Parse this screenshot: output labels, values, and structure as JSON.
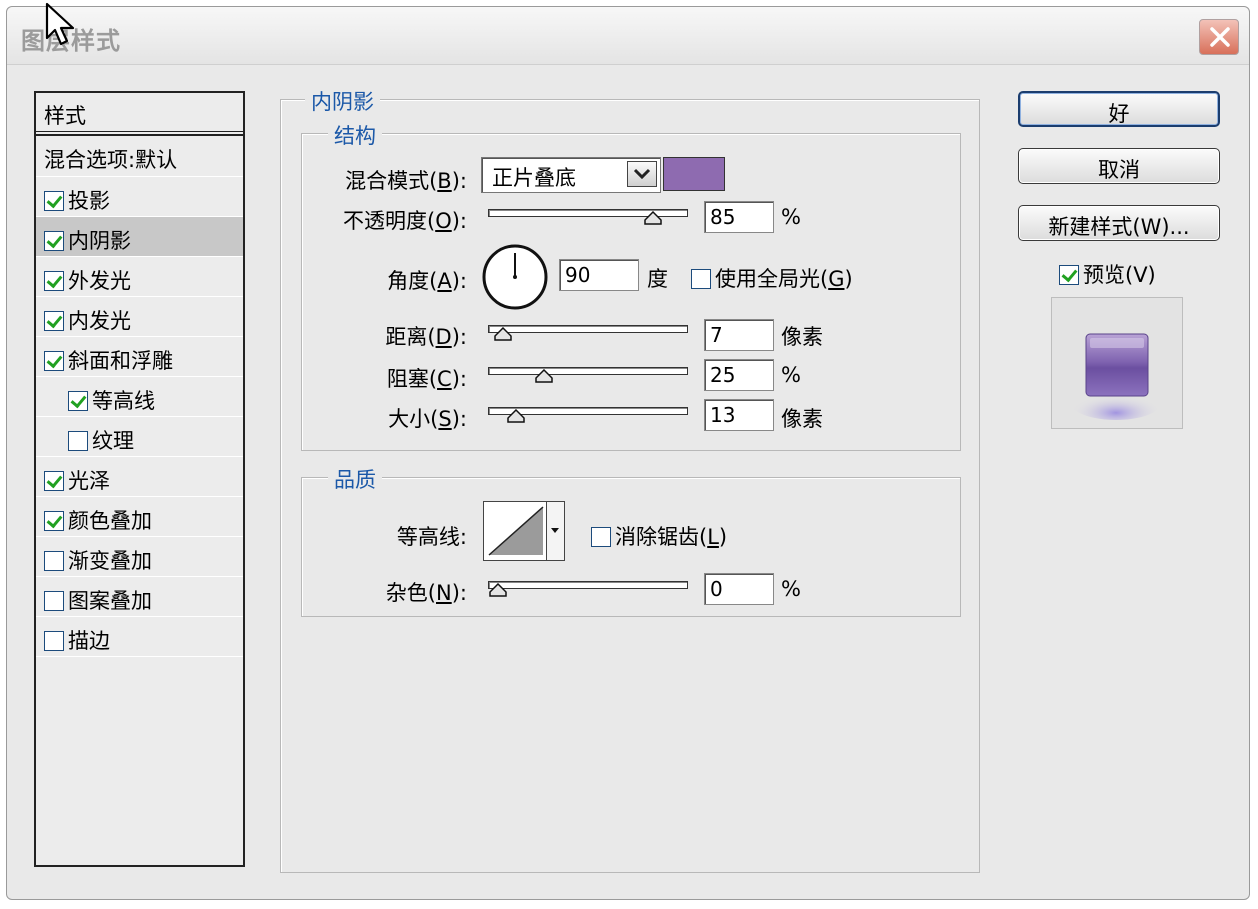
{
  "window": {
    "title": "图层样式"
  },
  "style_list": {
    "header": "样式",
    "blend_item": "混合选项:默认",
    "items": [
      {
        "label": "投影",
        "checked": true
      },
      {
        "label": "内阴影",
        "checked": true,
        "selected": true
      },
      {
        "label": "外发光",
        "checked": true
      },
      {
        "label": "内发光",
        "checked": true
      },
      {
        "label": "斜面和浮雕",
        "checked": true
      },
      {
        "label": "等高线",
        "checked": true,
        "sub": true
      },
      {
        "label": "纹理",
        "checked": false,
        "sub": true
      },
      {
        "label": "光泽",
        "checked": true
      },
      {
        "label": "颜色叠加",
        "checked": true
      },
      {
        "label": "渐变叠加",
        "checked": false
      },
      {
        "label": "图案叠加",
        "checked": false
      },
      {
        "label": "描边",
        "checked": false
      }
    ]
  },
  "inner_shadow": {
    "legend": "内阴影",
    "structure": {
      "legend": "结构",
      "blend_mode": {
        "label_pre": "混合模式(",
        "key": "B",
        "label_post": "):",
        "value": "正片叠底",
        "color": "#8e6bb0"
      },
      "opacity": {
        "label_pre": "不透明度(",
        "key": "O",
        "label_post": "):",
        "value": "85",
        "unit": "%",
        "fraction": 0.85
      },
      "angle": {
        "label_pre": "角度(",
        "key": "A",
        "label_post": "):",
        "value": "90",
        "unit": "度",
        "global_light_label_pre": "使用全局光(",
        "global_light_key": "G",
        "global_light_label_post": ")",
        "global_light_checked": false
      },
      "distance": {
        "label_pre": "距离(",
        "key": "D",
        "label_post": "):",
        "value": "7",
        "unit": "像素",
        "fraction": 0.03
      },
      "choke": {
        "label_pre": "阻塞(",
        "key": "C",
        "label_post": "):",
        "value": "25",
        "unit": "%",
        "fraction": 0.25
      },
      "size": {
        "label_pre": "大小(",
        "key": "S",
        "label_post": "):",
        "value": "13",
        "unit": "像素",
        "fraction": 0.1
      }
    },
    "quality": {
      "legend": "品质",
      "contour": {
        "label": "等高线:",
        "antialias_label_pre": "消除锯齿(",
        "antialias_key": "L",
        "antialias_label_post": ")",
        "antialias_checked": false
      },
      "noise": {
        "label_pre": "杂色(",
        "key": "N",
        "label_post": "):",
        "value": "0",
        "unit": "%",
        "fraction": 0.0
      }
    }
  },
  "buttons": {
    "ok": "好",
    "cancel": "取消",
    "new_style": "新建样式(W)..."
  },
  "preview": {
    "label": "预览(V)",
    "checked": true
  }
}
